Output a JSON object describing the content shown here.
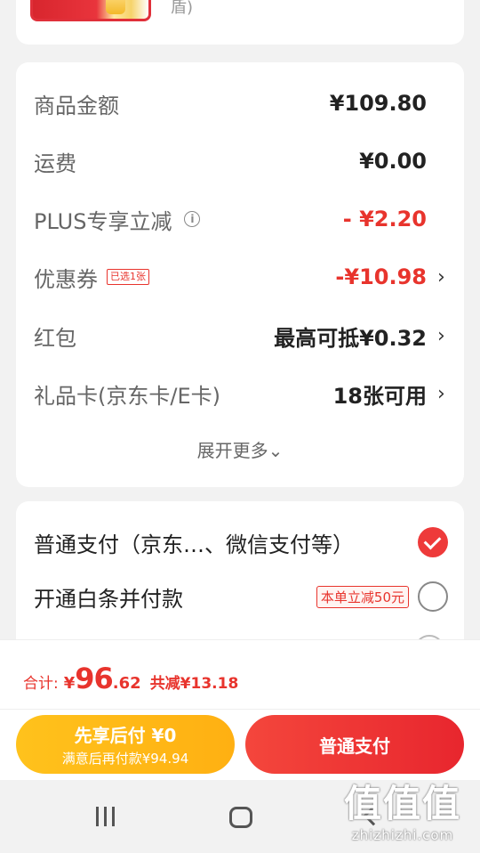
{
  "product_strip": {
    "tail_text": "盾)"
  },
  "summary": {
    "rows": [
      {
        "label": "商品金额",
        "value": "¥109.80"
      },
      {
        "label": "运费",
        "value": "¥0.00"
      },
      {
        "label": "PLUS专享立减",
        "value": "- ¥2.20"
      },
      {
        "label": "优惠券",
        "tag": "已选1张",
        "value": "-¥10.98"
      },
      {
        "label": "红包",
        "value": "最高可抵¥0.32"
      },
      {
        "label": "礼品卡(京东卡/E卡)",
        "value": "18张可用"
      }
    ],
    "expand_label": "展开更多",
    "expand_icon": "⌄"
  },
  "payment": {
    "options": [
      {
        "label": "普通支付（京东…、微信支付等）",
        "selected": true
      },
      {
        "label": "开通白条并付款",
        "promo": "本单立减50元",
        "selected": false
      }
    ]
  },
  "footer": {
    "total_label": "合计:",
    "total_yen": "¥",
    "total_int": "96",
    "total_dec": ".62",
    "total_saved": "共减¥13.18",
    "pay_later_title": "先享后付 ¥0",
    "pay_later_sub": "满意后再付款¥94.94",
    "pay_button": "普通支付"
  },
  "watermark": {
    "main": "值值值",
    "url": "zhizhizhi.com"
  },
  "colors": {
    "accent_red": "#e8342d",
    "pay_later_yellow": "#ffb012",
    "background": "#f2f2f2"
  }
}
